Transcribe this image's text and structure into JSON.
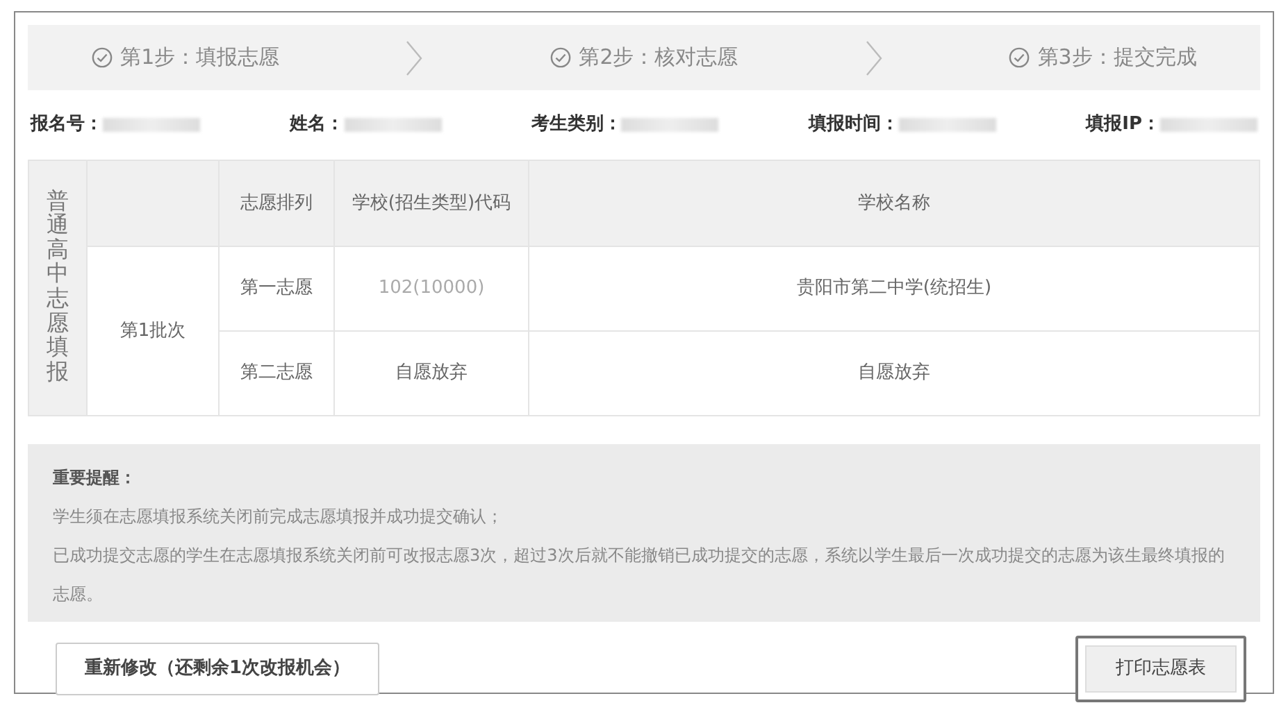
{
  "steps": [
    {
      "label": "第1步：填报志愿",
      "done": true
    },
    {
      "label": "第2步：核对志愿",
      "done": true
    },
    {
      "label": "第3步：提交完成",
      "done": true
    }
  ],
  "info": [
    {
      "label": "报名号："
    },
    {
      "label": "姓名："
    },
    {
      "label": "考生类别："
    },
    {
      "label": "填报时间："
    },
    {
      "label": "填报IP："
    }
  ],
  "table": {
    "section_title": "普通高中志愿填报",
    "columns": [
      "志愿排列",
      "学校(招生类型)代码",
      "学校名称"
    ],
    "batch": "第1批次",
    "rows": [
      {
        "rank": "第一志愿",
        "code": "102(10000)",
        "school": "贵阳市第二中学(统招生)"
      },
      {
        "rank": "第二志愿",
        "code": "自愿放弃",
        "school": "自愿放弃"
      }
    ]
  },
  "notice": {
    "title": "重要提醒：",
    "lines": [
      "学生须在志愿填报系统关闭前完成志愿填报并成功提交确认；",
      "已成功提交志愿的学生在志愿填报系统关闭前可改报志愿3次，超过3次后就不能撤销已成功提交的志愿，系统以学生最后一次成功提交的志愿为该生最终填报的志愿。"
    ]
  },
  "buttons": [
    {
      "label": "重新修改（还剩余1次改报机会）",
      "selected": false
    },
    {
      "label": "打印志愿表",
      "selected": true
    }
  ]
}
